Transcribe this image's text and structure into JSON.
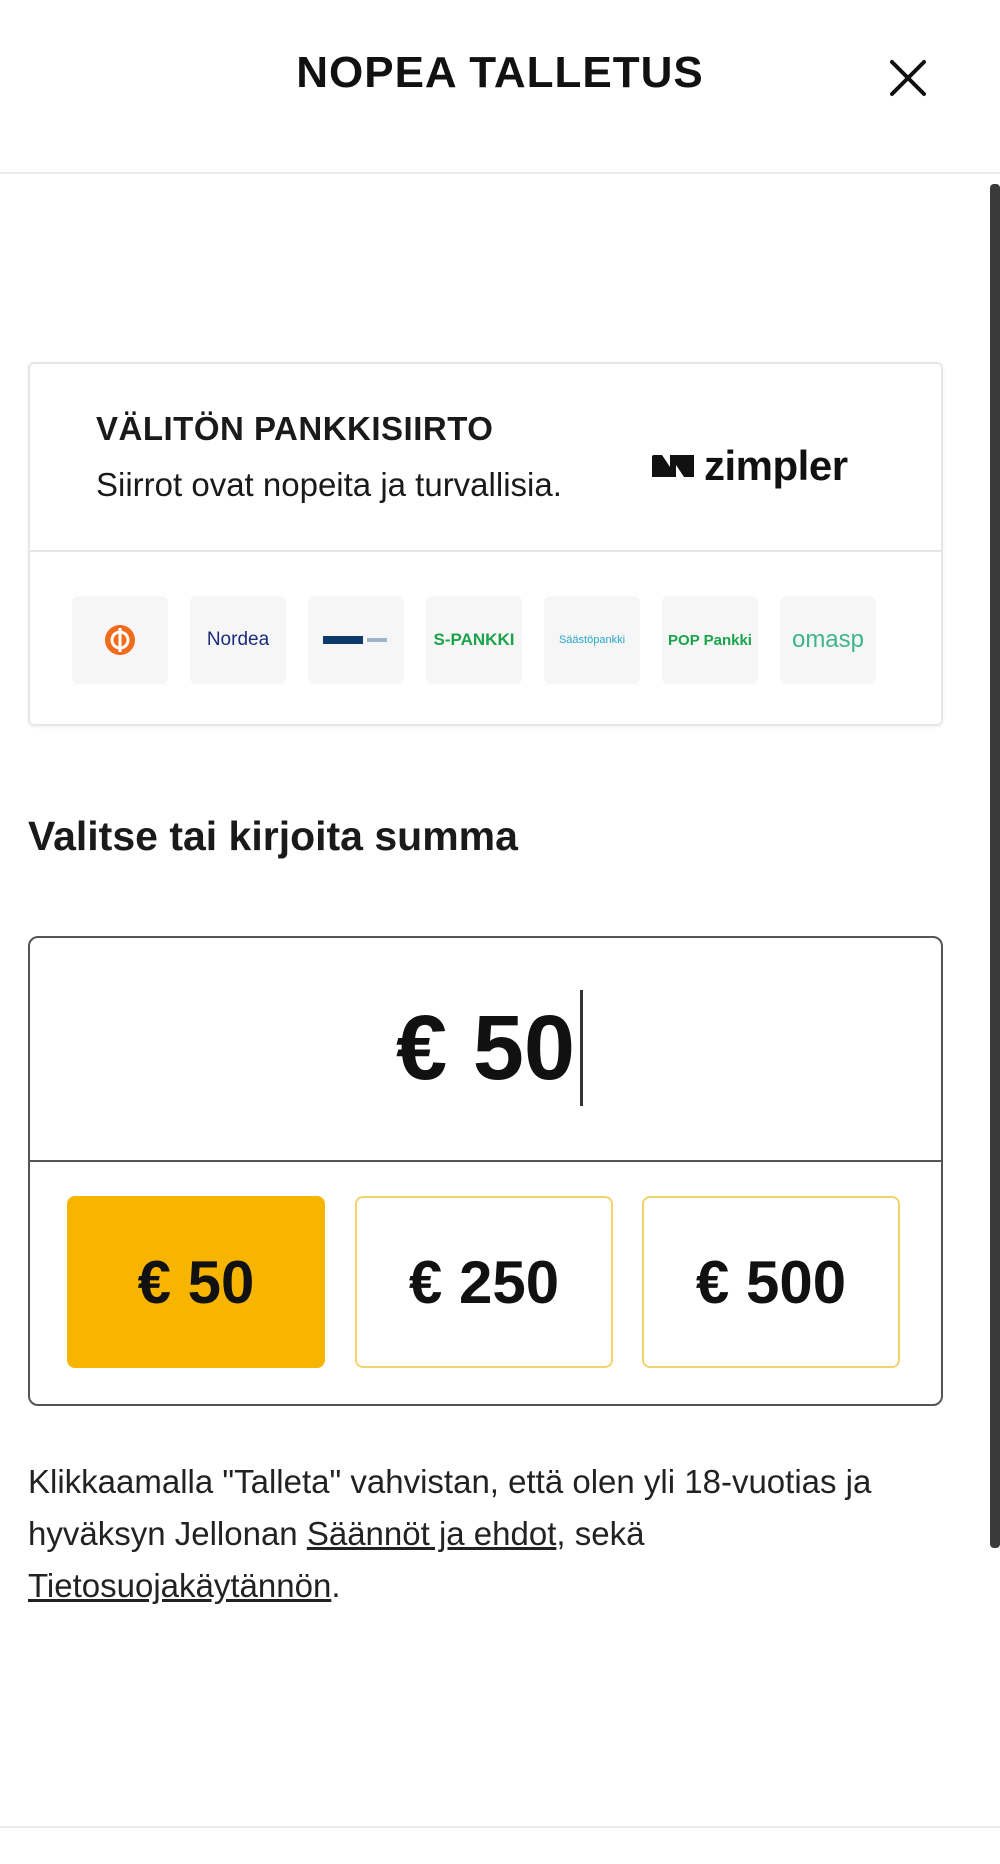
{
  "header": {
    "title": "NOPEA TALLETUS",
    "close_icon": "close-icon"
  },
  "bank_transfer": {
    "title": "VÄLITÖN PANKKISIIRTO",
    "subtitle": "Siirrot ovat nopeita ja turvallisia.",
    "provider": "zimpler",
    "banks": [
      "OP",
      "Nordea",
      "Danske Bank",
      "S-PANKKI",
      "Säästöpankki",
      "POP Pankki",
      "omasp"
    ]
  },
  "amount": {
    "heading": "Valitse tai kirjoita summa",
    "value": "€ 50",
    "presets": [
      "€ 50",
      "€ 250",
      "€ 500"
    ],
    "selected_index": 0
  },
  "terms": {
    "prefix": "Klikkaamalla \"Talleta\" vahvistan, että olen yli 18-vuotias ja hyväksyn Jellonan ",
    "link1": "Säännöt ja ehdot",
    "middle": ", sekä ",
    "link2": "Tietosuojakäytännön",
    "suffix": "."
  },
  "colors": {
    "accent": "#f7b500",
    "accent_border": "#f2d26b"
  }
}
